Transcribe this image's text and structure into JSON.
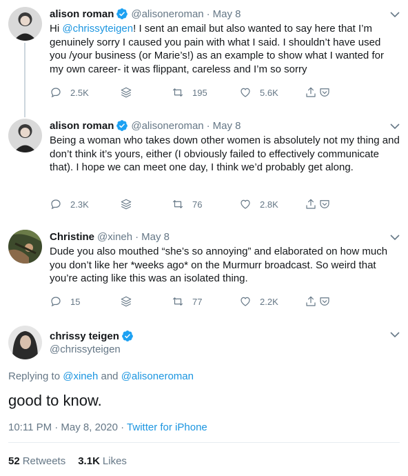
{
  "tweets": [
    {
      "name": "alison roman",
      "handle": "@alisoneroman",
      "time": "May 8",
      "text_mention": "@chrissyteigen",
      "text_pre": "Hi ",
      "text_post": "! I sent an email but also wanted to say here that I’m genuinely sorry I caused you pain with what I said. I shouldn’t have used you /your business (or Marie’s!) as an example to show what I wanted for my own career- it was flippant, careless and I’m so sorry",
      "replies": "2.5K",
      "retweets": "195",
      "likes": "5.6K",
      "verified": true
    },
    {
      "name": "alison roman",
      "handle": "@alisoneroman",
      "time": "May 8",
      "text": "Being a woman who takes down other women is absolutely not my thing and don’t think it’s yours, either (I obviously failed to effectively communicate that). I hope we can meet one day, I think we’d probably get along.",
      "replies": "2.3K",
      "retweets": "76",
      "likes": "2.8K",
      "verified": true
    },
    {
      "name": "Christine",
      "handle": "@xineh",
      "time": "May 8",
      "text": "Dude you also mouthed “she’s so annoying” and elaborated on how much you don’t like her *weeks ago* on the Murmurr broadcast. So weird that you’re acting like this was an isolated thing.",
      "replies": "15",
      "retweets": "77",
      "likes": "2.2K",
      "verified": false
    }
  ],
  "main": {
    "name": "chrissy teigen",
    "handle": "@chrissyteigen",
    "replying_prefix": "Replying to ",
    "replying_1": "@xineh",
    "replying_and": " and ",
    "replying_2": "@alisoneroman",
    "text": "good to know.",
    "timestamp": "10:11 PM · May 8, 2020 · ",
    "source": "Twitter for iPhone",
    "retweets_count": "52",
    "retweets_label": "Retweets",
    "likes_count": "3.1K",
    "likes_label": "Likes"
  },
  "dot": "·",
  "colors": {
    "accent": "#1b95e0",
    "muted": "#657786",
    "verified": "#1da1f2"
  }
}
